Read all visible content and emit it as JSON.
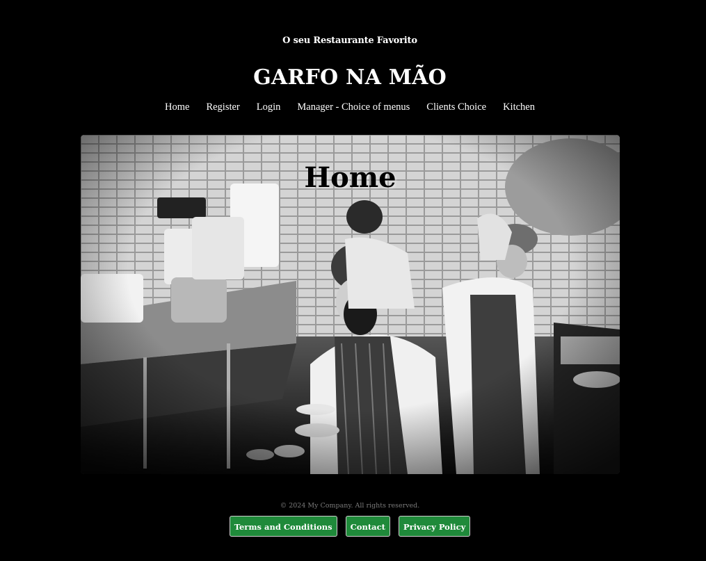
{
  "header": {
    "tagline": "O seu Restaurante Favorito",
    "brand": "GARFO NA MÃO"
  },
  "nav": {
    "items": [
      {
        "label": "Home"
      },
      {
        "label": "Register"
      },
      {
        "label": "Login"
      },
      {
        "label": "Manager - Choice of menus"
      },
      {
        "label": "Clients Choice"
      },
      {
        "label": "Kitchen"
      }
    ]
  },
  "hero": {
    "title": "Home",
    "image_subject": "black-and-white photo of chefs working in a restaurant kitchen"
  },
  "footer": {
    "copyright": "© 2024 My Company. All rights reserved.",
    "links": [
      {
        "label": "Terms and Conditions"
      },
      {
        "label": "Contact"
      },
      {
        "label": "Privacy Policy"
      }
    ],
    "button_color": "#1f8a3a"
  },
  "colors": {
    "background": "#000000",
    "text": "#ffffff"
  }
}
